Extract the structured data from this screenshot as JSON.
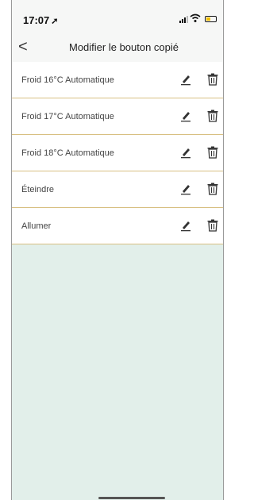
{
  "status_bar": {
    "time": "17:07",
    "location_glyph": "➚",
    "icons": [
      "signal-icon",
      "wifi-icon",
      "battery-charging-icon"
    ]
  },
  "nav": {
    "back_glyph": "<",
    "title": "Modifier le bouton copié"
  },
  "list": {
    "items": [
      {
        "label": "Froid 16°C Automatique"
      },
      {
        "label": "Froid 17°C Automatique"
      },
      {
        "label": "Froid 18°C Automatique"
      },
      {
        "label": "Éteindre"
      },
      {
        "label": "Allumer"
      }
    ],
    "row_icons": [
      "edit-icon",
      "trash-icon"
    ]
  },
  "colors": {
    "separator": "#d8c082",
    "empty_area": "#e2efea",
    "header_bg": "#f6f7f6",
    "battery_accent": "#f2c000"
  }
}
